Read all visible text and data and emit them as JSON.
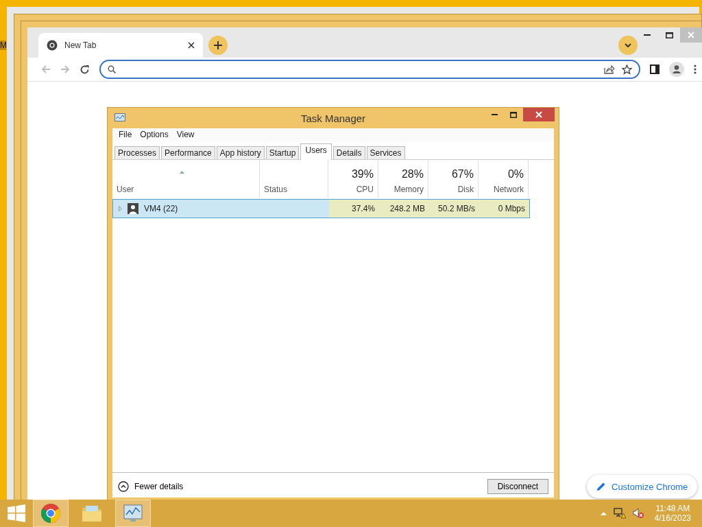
{
  "desktop": {
    "icon_label": "M"
  },
  "browser": {
    "tab_title": "New Tab",
    "customize_button": "Customize Chrome"
  },
  "task_manager": {
    "title": "Task Manager",
    "menu": [
      "File",
      "Options",
      "View"
    ],
    "tabs": [
      {
        "label": "Processes",
        "selected": false
      },
      {
        "label": "Performance",
        "selected": false
      },
      {
        "label": "App history",
        "selected": false
      },
      {
        "label": "Startup",
        "selected": false
      },
      {
        "label": "Users",
        "selected": true
      },
      {
        "label": "Details",
        "selected": false
      },
      {
        "label": "Services",
        "selected": false
      }
    ],
    "columns": [
      {
        "label": "User"
      },
      {
        "label": "Status"
      },
      {
        "percent": "39%",
        "label": "CPU"
      },
      {
        "percent": "28%",
        "label": "Memory"
      },
      {
        "percent": "67%",
        "label": "Disk"
      },
      {
        "percent": "0%",
        "label": "Network"
      }
    ],
    "rows": [
      {
        "user": "VM4 (22)",
        "selected": true,
        "expanded": false,
        "cpu": "37.4%",
        "memory": "248.2 MB",
        "disk": "50.2 MB/s",
        "network": "0 Mbps"
      }
    ],
    "fewer_details": "Fewer details",
    "disconnect_button": "Disconnect"
  },
  "taskbar": {
    "apps": [
      {
        "kind": "chrome",
        "selected": true
      },
      {
        "kind": "explorer",
        "selected": false
      },
      {
        "kind": "monitor",
        "selected": true
      }
    ],
    "time": "11:48 AM",
    "date": "4/16/2023"
  }
}
